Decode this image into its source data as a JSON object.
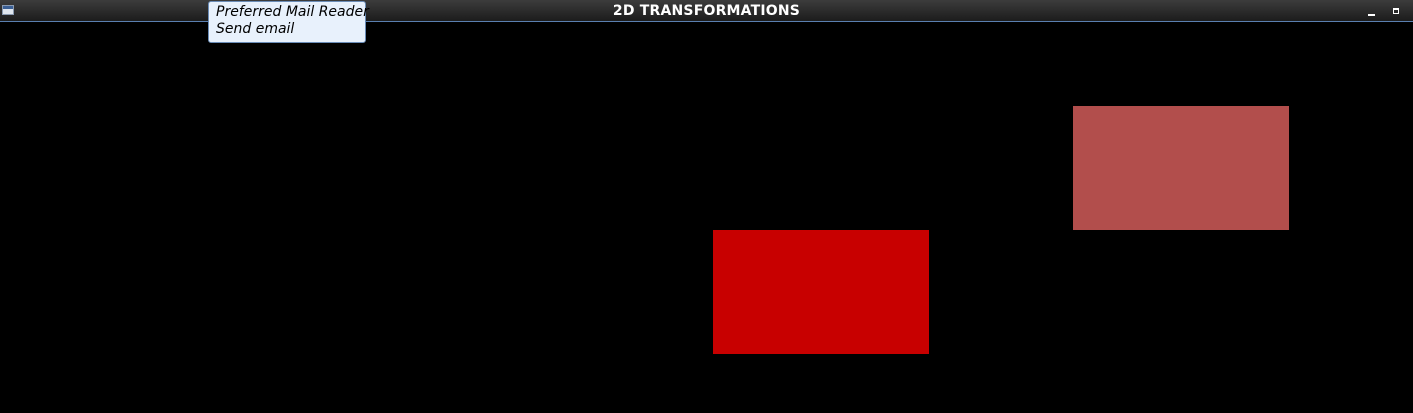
{
  "window": {
    "title": "2D TRANSFORMATIONS",
    "menu_icon": "window-menu-icon",
    "minimize_icon": "minimize-icon",
    "maximize_icon": "maximize-icon"
  },
  "tooltip": {
    "line1": "Preferred Mail Reader",
    "line2": "Send email"
  },
  "canvas": {
    "background": "#000000",
    "shapes": [
      {
        "name": "original-rectangle",
        "color": "#c80000"
      },
      {
        "name": "transformed-rectangle",
        "color": "#b24e4c"
      }
    ]
  }
}
